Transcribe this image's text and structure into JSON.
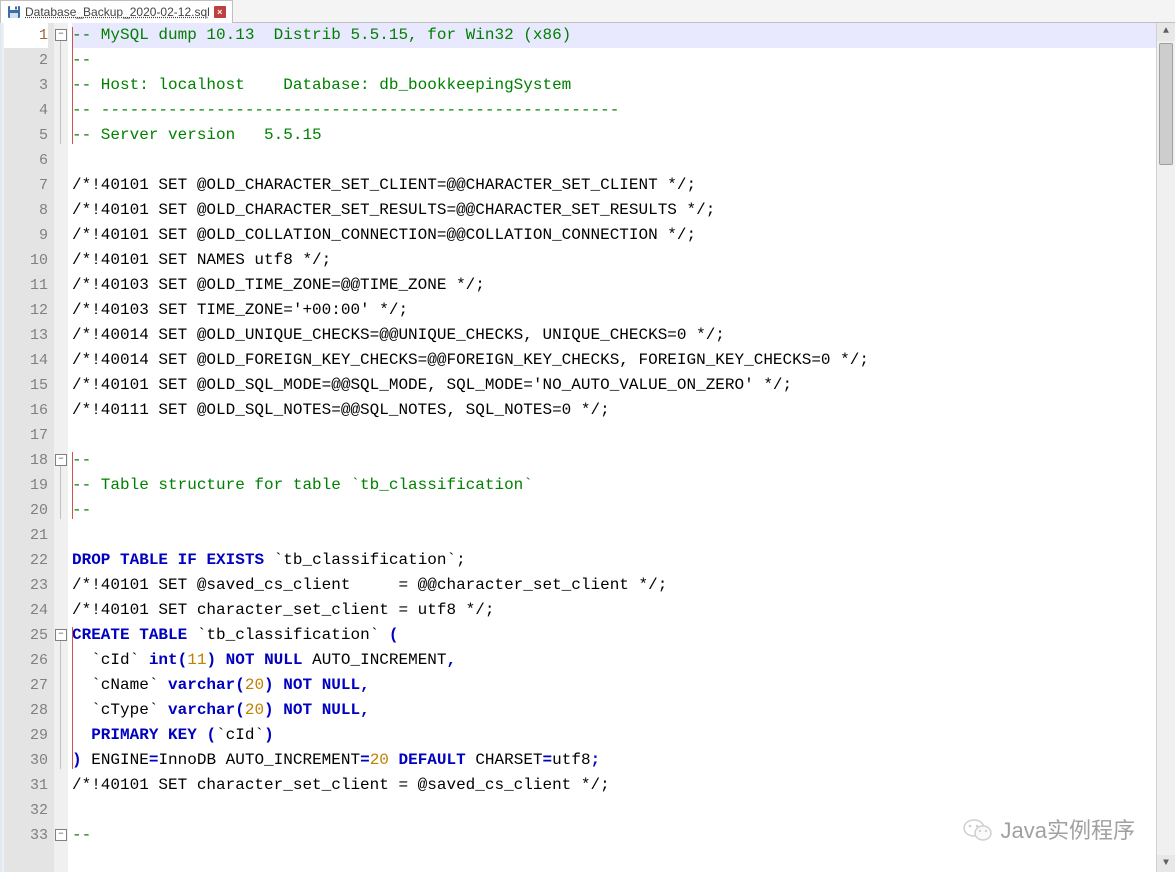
{
  "tab": {
    "filename": "Database_Backup_2020-02-12.sql"
  },
  "watermark": {
    "text": "Java实例程序"
  },
  "editor": {
    "cursor_line": 1,
    "fold_marks": [
      {
        "line": 1,
        "glyph": "−"
      },
      {
        "line": 18,
        "glyph": "−"
      },
      {
        "line": 25,
        "glyph": "−"
      },
      {
        "line": 33,
        "glyph": "−"
      }
    ],
    "fold_segments": [
      {
        "from": 1,
        "to": 5
      },
      {
        "from": 18,
        "to": 20
      },
      {
        "from": 25,
        "to": 30
      }
    ],
    "structure_segments": [
      {
        "from": 1,
        "to": 5
      },
      {
        "from": 18,
        "to": 20
      },
      {
        "from": 25,
        "to": 30
      }
    ],
    "lines": [
      {
        "n": 1,
        "tokens": [
          {
            "t": "-- MySQL dump 10.13  Distrib 5.5.15, for Win32 (x86)",
            "c": "comment"
          }
        ]
      },
      {
        "n": 2,
        "tokens": [
          {
            "t": "--",
            "c": "comment"
          }
        ]
      },
      {
        "n": 3,
        "tokens": [
          {
            "t": "-- Host: localhost    Database: db_bookkeepingSystem",
            "c": "comment"
          }
        ]
      },
      {
        "n": 4,
        "tokens": [
          {
            "t": "-- ------------------------------------------------------",
            "c": "comment"
          }
        ]
      },
      {
        "n": 5,
        "tokens": [
          {
            "t": "-- Server version   5.5.15",
            "c": "comment"
          }
        ]
      },
      {
        "n": 6,
        "tokens": []
      },
      {
        "n": 7,
        "tokens": [
          {
            "t": "/*!40101 SET @OLD_CHARACTER_SET_CLIENT=@@CHARACTER_SET_CLIENT */;",
            "c": ""
          }
        ]
      },
      {
        "n": 8,
        "tokens": [
          {
            "t": "/*!40101 SET @OLD_CHARACTER_SET_RESULTS=@@CHARACTER_SET_RESULTS */;",
            "c": ""
          }
        ]
      },
      {
        "n": 9,
        "tokens": [
          {
            "t": "/*!40101 SET @OLD_COLLATION_CONNECTION=@@COLLATION_CONNECTION */;",
            "c": ""
          }
        ]
      },
      {
        "n": 10,
        "tokens": [
          {
            "t": "/*!40101 SET NAMES utf8 */;",
            "c": ""
          }
        ]
      },
      {
        "n": 11,
        "tokens": [
          {
            "t": "/*!40103 SET @OLD_TIME_ZONE=@@TIME_ZONE */;",
            "c": ""
          }
        ]
      },
      {
        "n": 12,
        "tokens": [
          {
            "t": "/*!40103 SET TIME_ZONE='+00:00' */;",
            "c": ""
          }
        ]
      },
      {
        "n": 13,
        "tokens": [
          {
            "t": "/*!40014 SET @OLD_UNIQUE_CHECKS=@@UNIQUE_CHECKS, UNIQUE_CHECKS=0 */;",
            "c": ""
          }
        ]
      },
      {
        "n": 14,
        "tokens": [
          {
            "t": "/*!40014 SET @OLD_FOREIGN_KEY_CHECKS=@@FOREIGN_KEY_CHECKS, FOREIGN_KEY_CHECKS=0 */;",
            "c": ""
          }
        ]
      },
      {
        "n": 15,
        "tokens": [
          {
            "t": "/*!40101 SET @OLD_SQL_MODE=@@SQL_MODE, SQL_MODE='NO_AUTO_VALUE_ON_ZERO' */;",
            "c": ""
          }
        ]
      },
      {
        "n": 16,
        "tokens": [
          {
            "t": "/*!40111 SET @OLD_SQL_NOTES=@@SQL_NOTES, SQL_NOTES=0 */;",
            "c": ""
          }
        ]
      },
      {
        "n": 17,
        "tokens": []
      },
      {
        "n": 18,
        "tokens": [
          {
            "t": "--",
            "c": "comment"
          }
        ]
      },
      {
        "n": 19,
        "tokens": [
          {
            "t": "-- Table structure for table `tb_classification`",
            "c": "comment"
          }
        ]
      },
      {
        "n": 20,
        "tokens": [
          {
            "t": "--",
            "c": "comment"
          }
        ]
      },
      {
        "n": 21,
        "tokens": []
      },
      {
        "n": 22,
        "tokens": [
          {
            "t": "DROP",
            "c": "keyword"
          },
          {
            "t": " ",
            "c": ""
          },
          {
            "t": "TABLE",
            "c": "keyword"
          },
          {
            "t": " ",
            "c": ""
          },
          {
            "t": "IF",
            "c": "keyword"
          },
          {
            "t": " ",
            "c": ""
          },
          {
            "t": "EXISTS",
            "c": "keyword"
          },
          {
            "t": " `tb_classification`;",
            "c": ""
          }
        ]
      },
      {
        "n": 23,
        "tokens": [
          {
            "t": "/*!40101 SET @saved_cs_client     = @@character_set_client */;",
            "c": ""
          }
        ]
      },
      {
        "n": 24,
        "tokens": [
          {
            "t": "/*!40101 SET character_set_client = utf8 */;",
            "c": ""
          }
        ]
      },
      {
        "n": 25,
        "tokens": [
          {
            "t": "CREATE",
            "c": "keyword"
          },
          {
            "t": " ",
            "c": ""
          },
          {
            "t": "TABLE",
            "c": "keyword"
          },
          {
            "t": " `tb_classification` ",
            "c": ""
          },
          {
            "t": "(",
            "c": "keyword"
          }
        ]
      },
      {
        "n": 26,
        "tokens": [
          {
            "t": "  `cId` ",
            "c": ""
          },
          {
            "t": "int",
            "c": "keyword"
          },
          {
            "t": "(",
            "c": "keyword"
          },
          {
            "t": "11",
            "c": "number"
          },
          {
            "t": ")",
            "c": "keyword"
          },
          {
            "t": " ",
            "c": ""
          },
          {
            "t": "NOT",
            "c": "keyword"
          },
          {
            "t": " ",
            "c": ""
          },
          {
            "t": "NULL",
            "c": "keyword"
          },
          {
            "t": " AUTO_INCREMENT",
            "c": ""
          },
          {
            "t": ",",
            "c": "keyword"
          }
        ]
      },
      {
        "n": 27,
        "tokens": [
          {
            "t": "  `cName` ",
            "c": ""
          },
          {
            "t": "varchar",
            "c": "keyword"
          },
          {
            "t": "(",
            "c": "keyword"
          },
          {
            "t": "20",
            "c": "number"
          },
          {
            "t": ")",
            "c": "keyword"
          },
          {
            "t": " ",
            "c": ""
          },
          {
            "t": "NOT",
            "c": "keyword"
          },
          {
            "t": " ",
            "c": ""
          },
          {
            "t": "NULL",
            "c": "keyword"
          },
          {
            "t": ",",
            "c": "keyword"
          }
        ]
      },
      {
        "n": 28,
        "tokens": [
          {
            "t": "  `cType` ",
            "c": ""
          },
          {
            "t": "varchar",
            "c": "keyword"
          },
          {
            "t": "(",
            "c": "keyword"
          },
          {
            "t": "20",
            "c": "number"
          },
          {
            "t": ")",
            "c": "keyword"
          },
          {
            "t": " ",
            "c": ""
          },
          {
            "t": "NOT",
            "c": "keyword"
          },
          {
            "t": " ",
            "c": ""
          },
          {
            "t": "NULL",
            "c": "keyword"
          },
          {
            "t": ",",
            "c": "keyword"
          }
        ]
      },
      {
        "n": 29,
        "tokens": [
          {
            "t": "  ",
            "c": ""
          },
          {
            "t": "PRIMARY",
            "c": "keyword"
          },
          {
            "t": " ",
            "c": ""
          },
          {
            "t": "KEY",
            "c": "keyword"
          },
          {
            "t": " ",
            "c": ""
          },
          {
            "t": "(",
            "c": "keyword"
          },
          {
            "t": "`cId`",
            "c": ""
          },
          {
            "t": ")",
            "c": "keyword"
          }
        ]
      },
      {
        "n": 30,
        "tokens": [
          {
            "t": ")",
            "c": "keyword"
          },
          {
            "t": " ENGINE",
            "c": ""
          },
          {
            "t": "=",
            "c": "keyword"
          },
          {
            "t": "InnoDB AUTO_INCREMENT",
            "c": ""
          },
          {
            "t": "=",
            "c": "keyword"
          },
          {
            "t": "20",
            "c": "number"
          },
          {
            "t": " ",
            "c": ""
          },
          {
            "t": "DEFAULT",
            "c": "keyword"
          },
          {
            "t": " CHARSET",
            "c": ""
          },
          {
            "t": "=",
            "c": "keyword"
          },
          {
            "t": "utf8",
            "c": ""
          },
          {
            "t": ";",
            "c": "keyword"
          }
        ]
      },
      {
        "n": 31,
        "tokens": [
          {
            "t": "/*!40101 SET character_set_client = @saved_cs_client */;",
            "c": ""
          }
        ]
      },
      {
        "n": 32,
        "tokens": []
      },
      {
        "n": 33,
        "tokens": [
          {
            "t": "--",
            "c": "comment"
          }
        ]
      }
    ]
  }
}
